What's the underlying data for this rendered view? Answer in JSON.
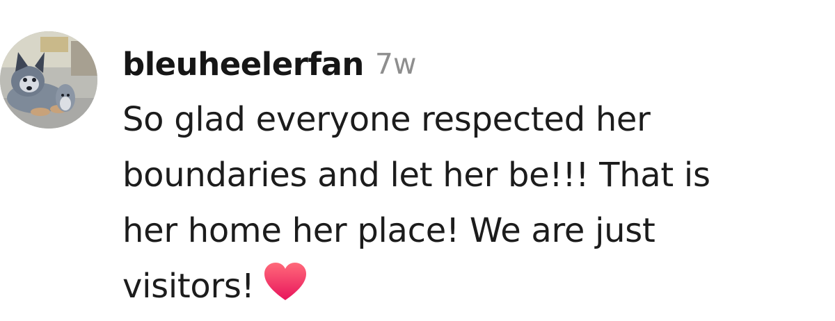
{
  "comment": {
    "username": "bleuheelerfan",
    "timestamp": "7w",
    "text_lines": [
      "So glad everyone respected her",
      "boundaries and let her be!!! That is",
      "her home her place! We are just",
      "visitors!"
    ],
    "emoji": "heart-emoji",
    "avatar": "profile-avatar-dog-photo"
  },
  "colors": {
    "username": "#161616",
    "timestamp": "#8e8e8e",
    "text": "#1c1c1c",
    "heart": "#f0366a"
  }
}
